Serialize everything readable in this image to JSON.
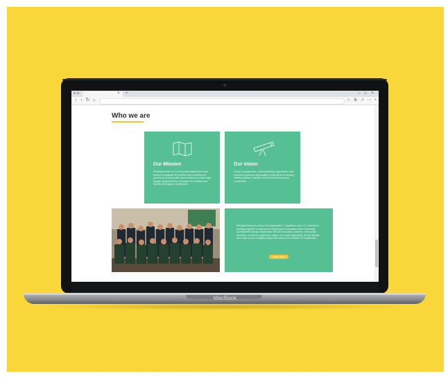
{
  "laptop": {
    "brand_label": "MacBook"
  },
  "browser": {
    "tab_title": "",
    "tab_close_glyph": "×",
    "new_tab_glyph": "+",
    "nav_back_glyph": "‹",
    "nav_forward_glyph": "›",
    "reload_glyph": "↻",
    "home_glyph": "⌂",
    "minimize_glyph": "–",
    "maximize_glyph": "□",
    "close_glyph": "×",
    "url": ""
  },
  "page": {
    "heading": "Who we are",
    "mission": {
      "title": "Our Mission",
      "text": "Planting Seeds is a not for profit organization that seeks to eradicate the barriers that contribute to poverty by working with communities to provide high quality comprehensive education for children and families throughout Guatemala."
    },
    "vision": {
      "title": "Our vision",
      "text": "Create a progressive, self-sustaining organization that improves access to and quality of education to develop healthy children, families, and communities across Guatemala."
    },
    "about": {
      "text": "Planting Seeds is a team of Guatemalans, Canadians, and U.S. Americans working together to improve the landscape of education and community development across Guatemala. We are educators, parents, community members, students, supporters, allies, and most importantly, human beings who hope to see a brighter future with and for the children of Guatemala.",
      "button_label": "Learn more"
    }
  },
  "colors": {
    "background": "#f9d639",
    "card_green": "#56bf94",
    "accent_yellow": "#f4c431",
    "heading": "#2e2e2e"
  },
  "icons": {
    "mission": "map-icon",
    "vision": "telescope-icon"
  }
}
